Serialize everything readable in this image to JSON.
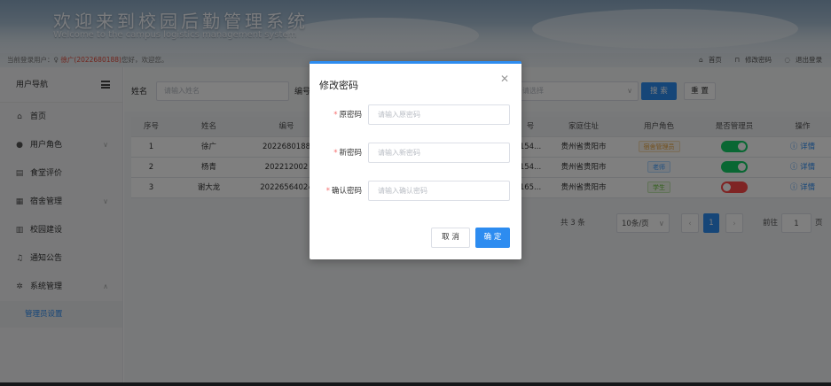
{
  "header": {
    "title": "欢迎来到校园后勤管理系统",
    "subtitle": "Welcome to the campus logistics management system"
  },
  "subbar": {
    "prefix": "当前登录用户：",
    "user": "徐广(2022680188)",
    "greeting": "您好，欢迎您。",
    "home_label": "首页",
    "change_pwd_label": "修改密码",
    "logout_label": "退出登录"
  },
  "sidebar": {
    "title": "用户导航",
    "items": [
      {
        "label": "首页",
        "icon": "home-icon"
      },
      {
        "label": "用户角色",
        "icon": "user-icon"
      },
      {
        "label": "食堂评价",
        "icon": "document-icon"
      },
      {
        "label": "宿舍管理",
        "icon": "building-icon"
      },
      {
        "label": "校园建设",
        "icon": "construction-icon"
      },
      {
        "label": "通知公告",
        "icon": "bell-icon"
      },
      {
        "label": "系统管理",
        "icon": "gear-icon"
      }
    ],
    "sub_item": "管理员设置"
  },
  "search": {
    "name_label": "姓名",
    "name_placeholder": "请输入姓名",
    "id_label": "编号",
    "role_placeholder": "请选择",
    "search_button": "搜 索",
    "reset_button": "重 置"
  },
  "table": {
    "headers": [
      "序号",
      "姓名",
      "编号",
      "号",
      "家庭住址",
      "用户角色",
      "是否管理员",
      "操作"
    ],
    "rows": [
      {
        "index": "1",
        "name": "徐广",
        "id": "2022680188",
        "phone": "154...",
        "address": "贵州省贵阳市",
        "role": "宿舍管理员",
        "admin": true,
        "action": "详情"
      },
      {
        "index": "2",
        "name": "杨青",
        "id": "202212002",
        "phone": "154...",
        "address": "贵州省贵阳市",
        "role": "老师",
        "admin": true,
        "action": "详情"
      },
      {
        "index": "3",
        "name": "谢大龙",
        "id": "20226564024",
        "phone": "165...",
        "address": "贵州省贵阳市",
        "role": "学生",
        "admin": false,
        "action": "详情"
      }
    ]
  },
  "pager": {
    "total": "共 3 条",
    "page_size": "10条/页",
    "current_page": "1",
    "goto_label": "前往",
    "goto_value": "1",
    "page_unit": "页"
  },
  "modal": {
    "title": "修改密码",
    "fields": [
      {
        "label": "原密码",
        "placeholder": "请输入原密码"
      },
      {
        "label": "新密码",
        "placeholder": "请输入新密码"
      },
      {
        "label": "确认密码",
        "placeholder": "请输入确认密码"
      }
    ],
    "cancel": "取 消",
    "confirm": "确 定"
  },
  "colors": {
    "primary": "#2d8cf0",
    "switch_on": "#13ce66",
    "switch_off": "#ff4949",
    "tag_manager": "#e6a23c",
    "tag_teacher": "#409eff",
    "tag_student": "#67c23a"
  }
}
